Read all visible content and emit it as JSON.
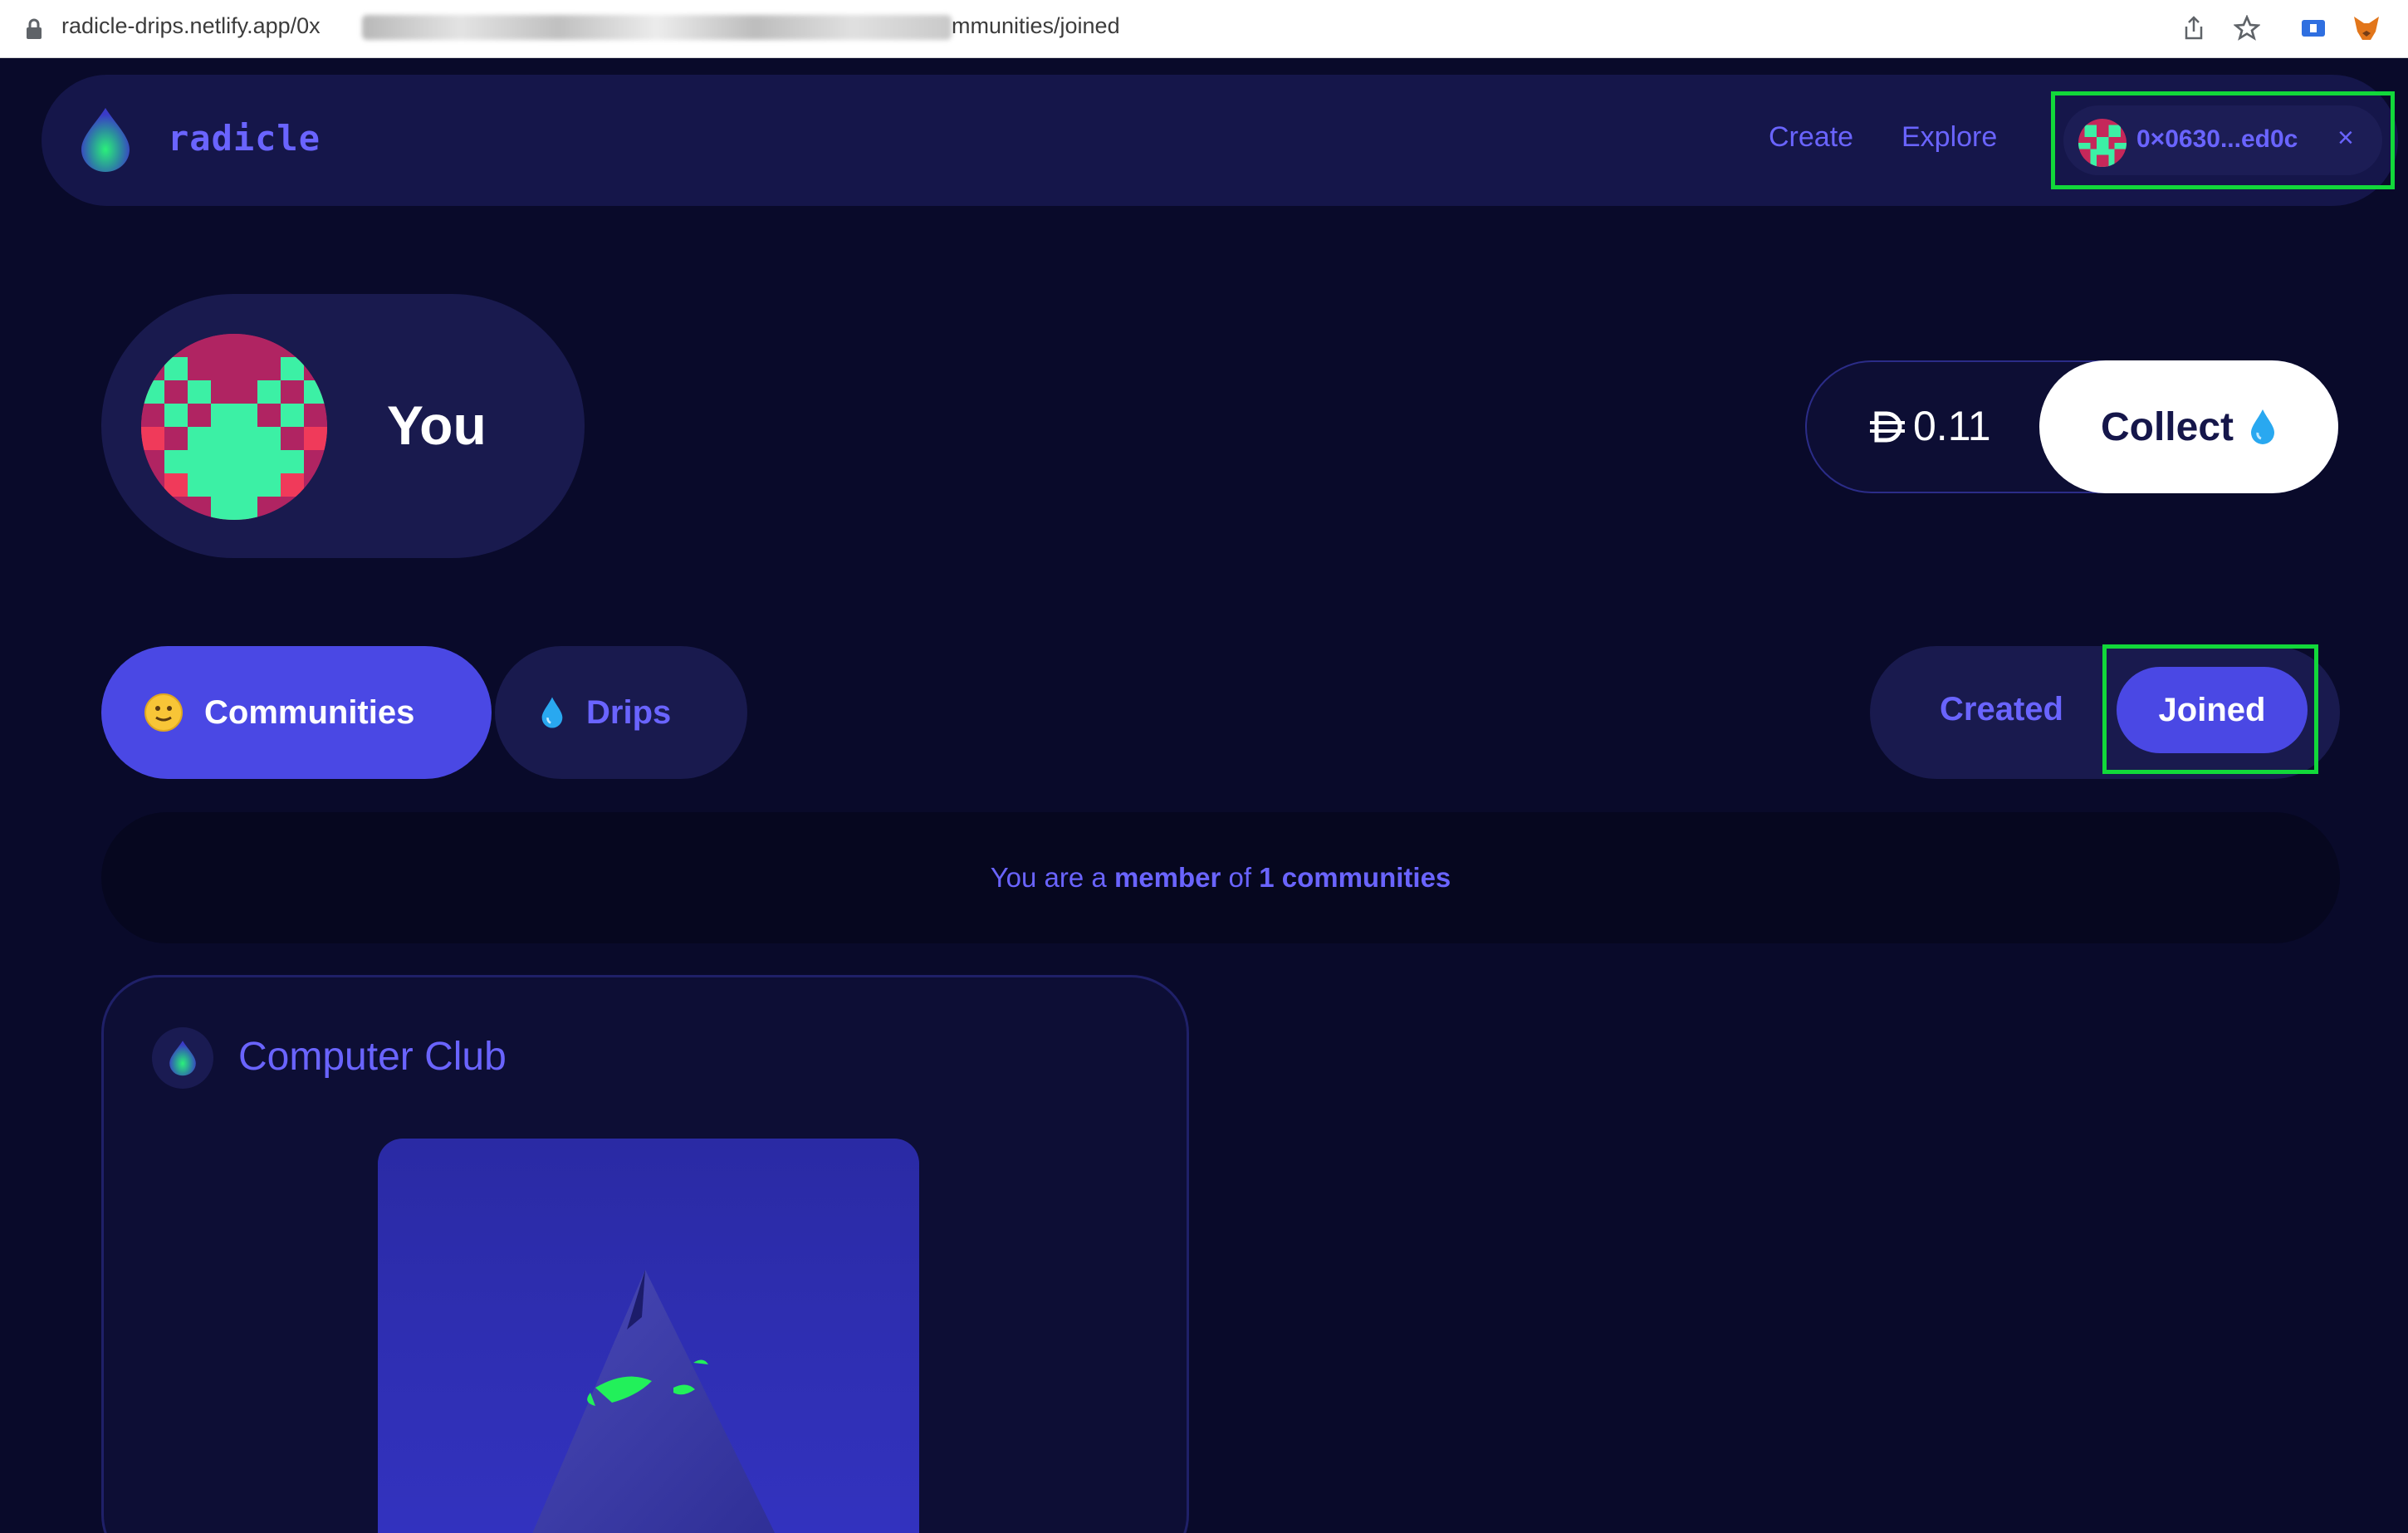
{
  "browser": {
    "url_prefix": "radicle-drips.netlify.app/0x",
    "url_suffix": "mmunities/joined"
  },
  "header": {
    "logo_text": "radicle",
    "nav": [
      {
        "label": "Create"
      },
      {
        "label": "Explore"
      }
    ],
    "wallet": {
      "address": "0×0630...ed0c",
      "close_symbol": "×"
    }
  },
  "profile": {
    "name": "You"
  },
  "balance": {
    "value": "0.11",
    "collect_label": "Collect"
  },
  "tabs": [
    {
      "label": "Communities",
      "active": true
    },
    {
      "label": "Drips",
      "active": false
    }
  ],
  "filters": {
    "created_label": "Created",
    "joined_label": "Joined",
    "active": "Joined"
  },
  "summary": {
    "prefix": "You are a",
    "role": "member",
    "middle": "of",
    "count": "1 communities"
  },
  "communities": [
    {
      "name": "Computer Club"
    }
  ],
  "colors": {
    "background": "#090a2a",
    "accent": "#6a64ff",
    "primary": "#4a48e4",
    "highlight_box": "#12d83a",
    "avatar_red": "#c5285a",
    "avatar_green": "#3cf0a5"
  }
}
